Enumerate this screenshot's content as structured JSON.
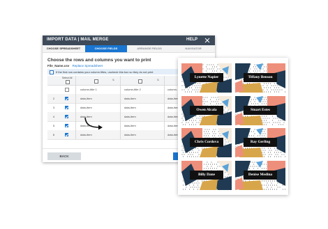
{
  "dialog": {
    "title": "IMPORT DATA | MAIL MERGE",
    "help": "HELP",
    "tabs": [
      {
        "label": "CHOOSE SPREADSHEET"
      },
      {
        "label": "CHOOSE FIELDS"
      },
      {
        "label": "ARRANGE FIELDS"
      },
      {
        "label": "NAVIGATOR"
      }
    ],
    "active_tab": "CHOOSE FIELDS",
    "heading": "Choose the rows and columns you want to print",
    "file_name": "File_Name.csv",
    "replace_link": "Replace Spreadsheet",
    "header_row_hint": "If the first row contains your column titles, uncheck this box so they do not print",
    "select_all_label": "Select All",
    "table": {
      "rows": [
        {
          "num": "",
          "checked": false,
          "cells": [
            "column-title 1",
            "column-title 2",
            "column-"
          ]
        },
        {
          "num": "2",
          "checked": true,
          "cells": [
            "data-item",
            "data-item",
            "data-item"
          ]
        },
        {
          "num": "3",
          "checked": true,
          "cells": [
            "data-item",
            "data-item",
            "data-item"
          ]
        },
        {
          "num": "4",
          "checked": true,
          "cells": [
            "data-item",
            "data-item",
            "data-item"
          ]
        },
        {
          "num": "5",
          "checked": true,
          "cells": [
            "data-item",
            "data-item",
            "data-item"
          ]
        },
        {
          "num": "6",
          "checked": true,
          "cells": [
            "data-item",
            "data-item",
            "data-item"
          ]
        }
      ]
    },
    "back_label": "BACK"
  },
  "place_cards": {
    "names": [
      "Lynette Napier",
      "Tiffany Benson",
      "Owen Alcala",
      "Stuart Estes",
      "Chris Cordova",
      "Ray Gerling",
      "Billy Dane",
      "Denise Medina"
    ]
  },
  "colors": {
    "header": "#3d4a5a",
    "accent": "#1976d2",
    "card_navy": "#1f3a52",
    "card_coral": "#ee8f7b",
    "card_mustard": "#d8a64a",
    "card_blue": "#5aa2d8",
    "card_cream": "#f4eadc"
  }
}
